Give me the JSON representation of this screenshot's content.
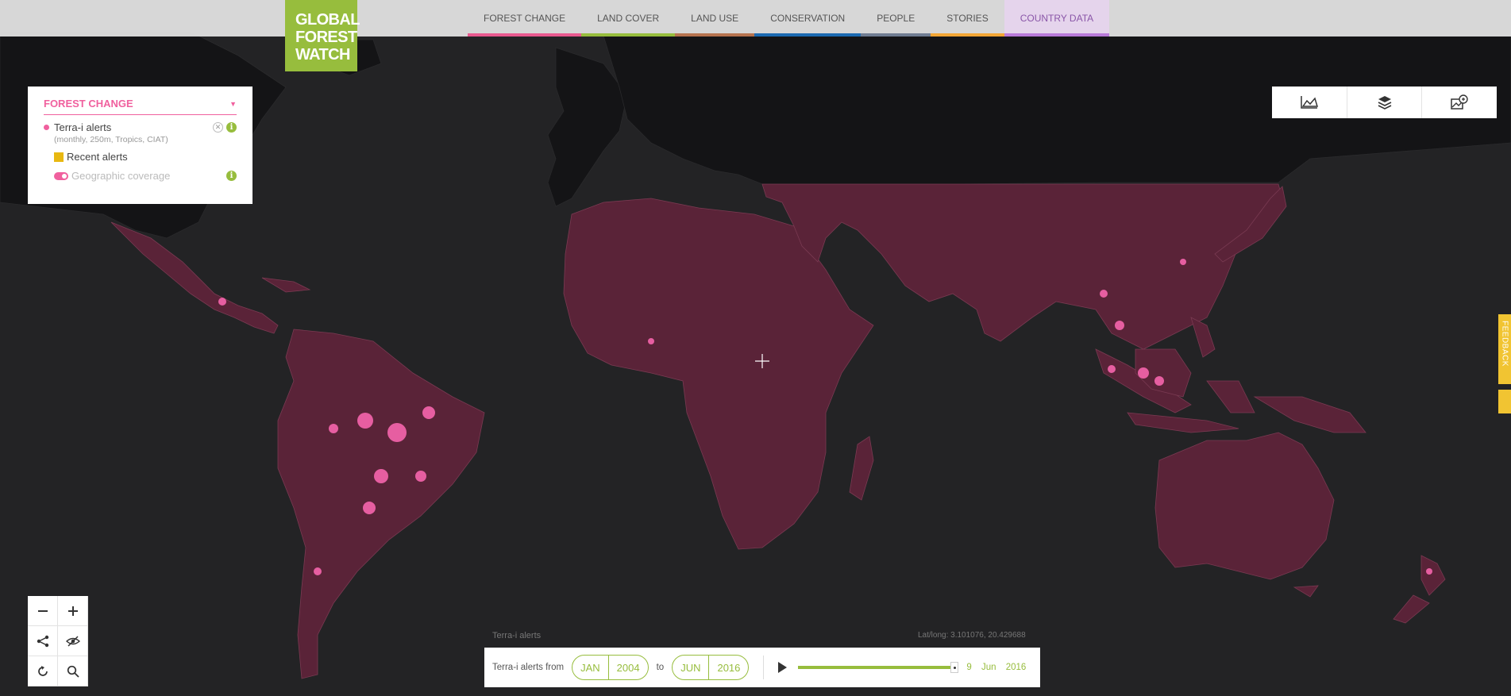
{
  "logo": {
    "line1": "GLOBAL",
    "line2": "FOREST",
    "line3": "WATCH"
  },
  "nav": {
    "items": [
      {
        "label": "FOREST CHANGE",
        "color": "#e9598f"
      },
      {
        "label": "LAND COVER",
        "color": "#97bd3d"
      },
      {
        "label": "LAND USE",
        "color": "#b6734f"
      },
      {
        "label": "CONSERVATION",
        "color": "#1c6ab1"
      },
      {
        "label": "PEOPLE",
        "color": "#707d92"
      },
      {
        "label": "STORIES",
        "color": "#f3a635"
      },
      {
        "label": "COUNTRY DATA",
        "color": "#b97ad9"
      }
    ]
  },
  "legend": {
    "category": "FOREST CHANGE",
    "layer_name": "Terra-i alerts",
    "layer_meta": "(monthly, 250m, Tropics, CIAT)",
    "recent_label": "Recent alerts",
    "coverage_label": "Geographic coverage"
  },
  "feedback_label": "FEEDBACK",
  "timeline": {
    "label": "Terra-i alerts from",
    "from_month": "JAN",
    "from_year": "2004",
    "to_label": "to",
    "to_month": "JUN",
    "to_year": "2016",
    "current_day": "9",
    "current_month": "Jun",
    "current_year": "2016",
    "progress": 1.0
  },
  "attribution": {
    "layer": "Terra-i alerts",
    "latlng": "Lat/long: 3.101076, 20.429688"
  },
  "colors": {
    "accent_pink": "#f0609e",
    "brand_green": "#97bd3d",
    "coverage": "#6a2a44",
    "alert_yellow": "#e8b811"
  },
  "icons": {
    "right_toolbar": [
      "chart-icon",
      "layers-icon",
      "basemap-icon"
    ],
    "map_controls": [
      "zoom-out-icon",
      "zoom-in-icon",
      "share-icon",
      "hide-icon",
      "reset-icon",
      "search-icon"
    ]
  }
}
